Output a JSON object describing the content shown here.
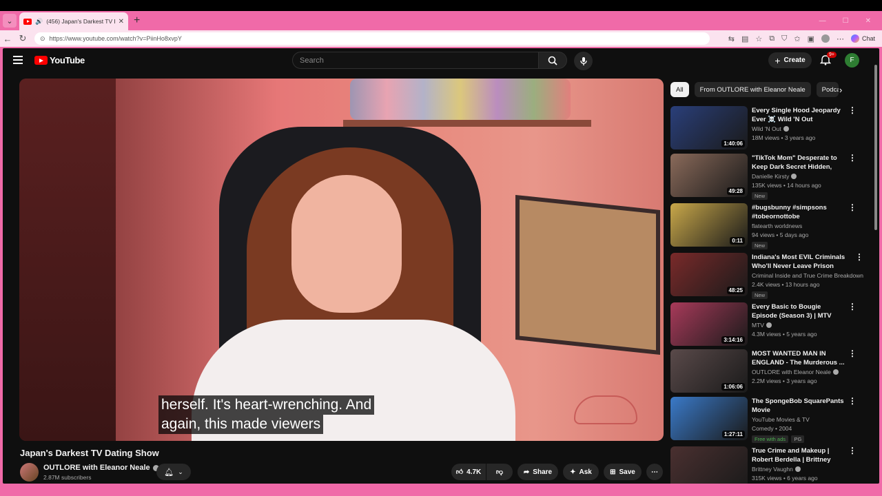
{
  "browser": {
    "tab_title": "(456) Japan's Darkest TV Dati",
    "url": "https://www.youtube.com/watch?v=PiinHo8xvpY",
    "chat_label": "Chat"
  },
  "masthead": {
    "logo_text": "YouTube",
    "search_placeholder": "Search",
    "create_label": "Create",
    "notification_badge": "9+",
    "account_initial": "F"
  },
  "video": {
    "caption_line1": "herself. It's heart-wrenching. And",
    "caption_line2": "again, this made viewers",
    "title": "Japan's Darkest TV Dating Show",
    "channel": "OUTLORE with Eleanor Neale",
    "subscribers": "2.87M subscribers",
    "likes": "4.7K",
    "share_label": "Share",
    "ask_label": "Ask",
    "save_label": "Save"
  },
  "chips": [
    "All",
    "From OUTLORE with Eleanor Neale",
    "Podca"
  ],
  "recommendations": [
    {
      "title": "Every Single Hood Jeopardy Ever ☠️ Wild 'N Out",
      "channel": "Wild 'N Out",
      "verified": true,
      "views": "18M views • 3 years ago",
      "duration": "1:40:06",
      "badge": "",
      "color": "#2a3f7a"
    },
    {
      "title": "\"TikTok Mom\" Desperate to Keep Dark Secret Hidden, then...",
      "channel": "Danielle Kirsty",
      "verified": true,
      "views": "135K views • 14 hours ago",
      "duration": "49:28",
      "badge": "New",
      "color": "#8a6a5a"
    },
    {
      "title": "#bugsbunny #simpsons #tobeornottobe",
      "channel": "flatearth worldnews",
      "verified": false,
      "views": "94 views • 5 days ago",
      "duration": "0:11",
      "badge": "New",
      "color": "#c9a84a"
    },
    {
      "title": "Indiana's Most EVIL Criminals Who'll Never Leave Prison",
      "channel": "Criminal Inside and True Crime Breakdown",
      "verified": false,
      "views": "2.4K views • 13 hours ago",
      "duration": "48:25",
      "badge": "New",
      "color": "#7a2a2a"
    },
    {
      "title": "Every Basic to Bougie Episode (Season 3) | MTV",
      "channel": "MTV",
      "verified": true,
      "views": "4.3M views • 5 years ago",
      "duration": "3:14:16",
      "badge": "",
      "color": "#a83a5a"
    },
    {
      "title": "MOST WANTED MAN IN ENGLAND - The Murderous ...",
      "channel": "OUTLORE with Eleanor Neale",
      "verified": true,
      "views": "2.2M views • 3 years ago",
      "duration": "1:06:06",
      "badge": "",
      "color": "#5a4a4a"
    },
    {
      "title": "The SpongeBob SquarePants Movie",
      "channel": "YouTube Movies & TV",
      "verified": false,
      "views": "Comedy • 2004",
      "duration": "1:27:11",
      "badge": "Free with ads",
      "badge2": "PG",
      "color": "#3a7ac9"
    },
    {
      "title": "True Crime and Makeup | Robert Berdella | Brittney Vaughn",
      "channel": "Brittney Vaughn",
      "verified": true,
      "views": "315K views • 6 years ago",
      "duration": "",
      "badge": "",
      "color": "#4a3030"
    }
  ]
}
